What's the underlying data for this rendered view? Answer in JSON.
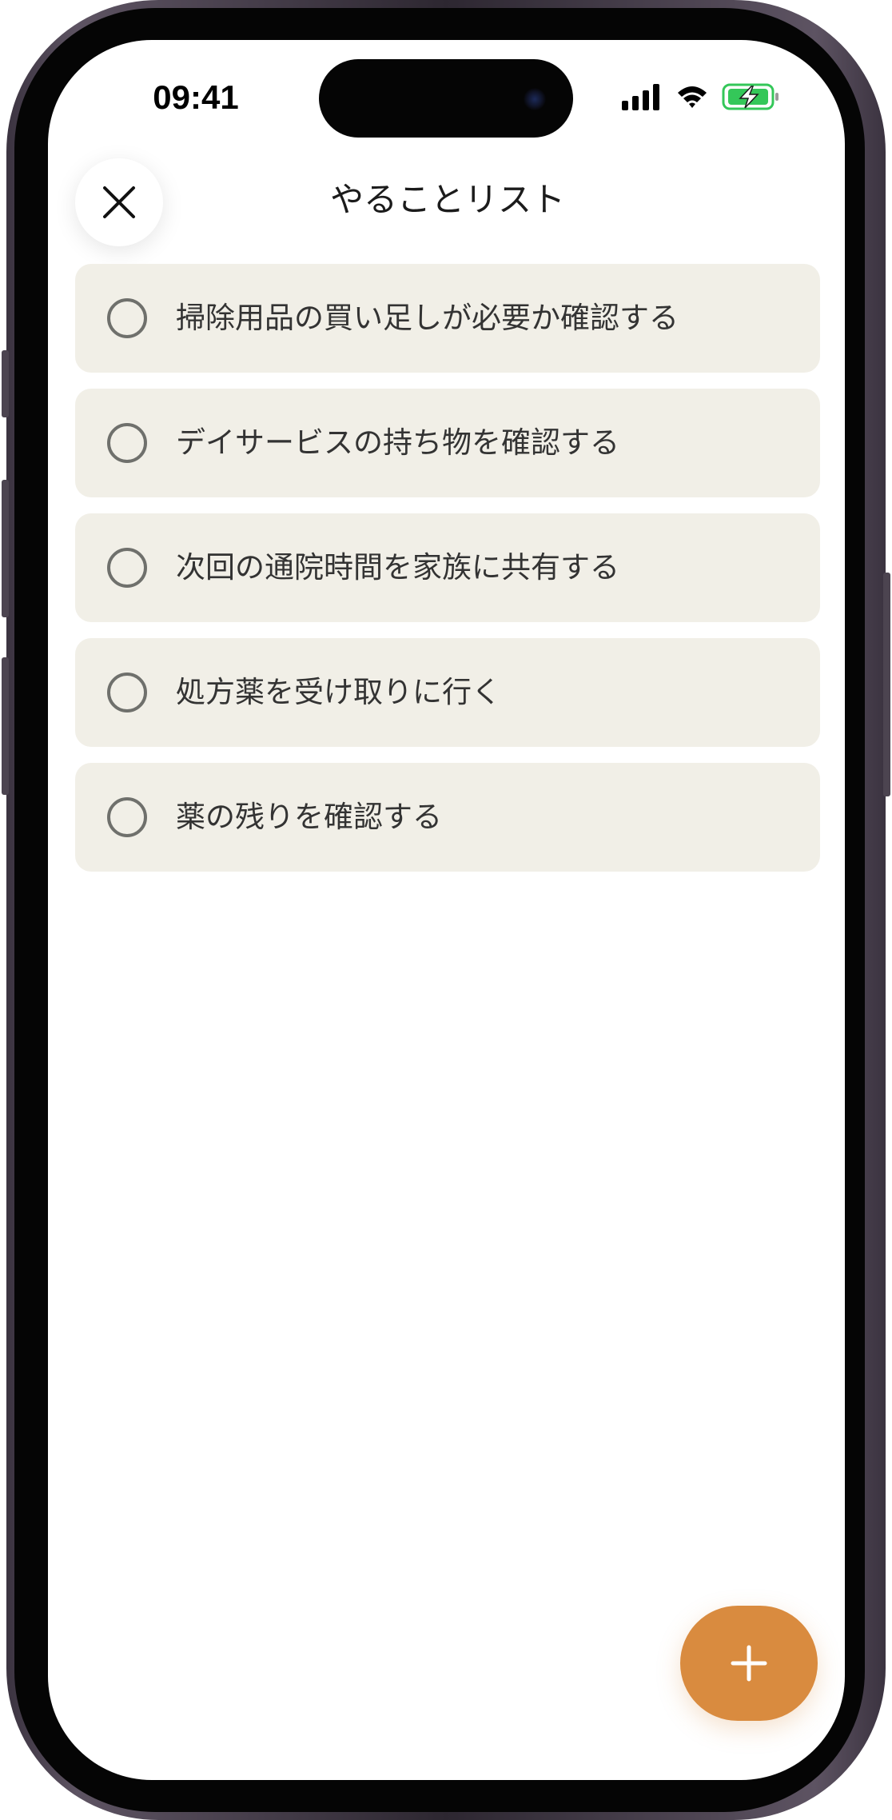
{
  "status_bar": {
    "time": "09:41",
    "icons": [
      "cellular-signal-icon",
      "wifi-icon",
      "battery-charging-icon"
    ],
    "battery_color": "#34c759"
  },
  "header": {
    "title": "やることリスト",
    "close_icon": "close-icon"
  },
  "todo_items": [
    {
      "label": "掃除用品の買い足しが必要か確認する",
      "done": false
    },
    {
      "label": "デイサービスの持ち物を確認する",
      "done": false
    },
    {
      "label": "次回の通院時間を家族に共有する",
      "done": false
    },
    {
      "label": "処方薬を受け取りに行く",
      "done": false
    },
    {
      "label": "薬の残りを確認する",
      "done": false
    }
  ],
  "fab": {
    "icon": "plus-icon"
  },
  "colors": {
    "item_background": "#f1efe7",
    "accent": "#d98b3f",
    "text": "#333333",
    "checkbox_border": "#6f706c"
  }
}
